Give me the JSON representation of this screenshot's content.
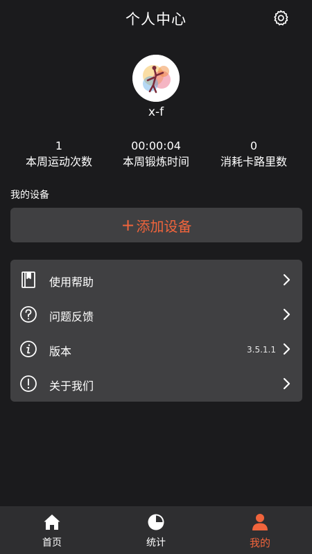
{
  "header": {
    "title": "个人中心",
    "settings_icon": "gear-icon"
  },
  "profile": {
    "username": "x-f",
    "avatar_icon": "runner-avatar-image"
  },
  "stats": [
    {
      "value": "1",
      "label": "本周运动次数"
    },
    {
      "value": "00:00:04",
      "label": "本周锻炼时间"
    },
    {
      "value": "0",
      "label": "消耗卡路里数"
    }
  ],
  "devices": {
    "section_title": "我的设备",
    "add_plus": "+",
    "add_label": "添加设备"
  },
  "menu": {
    "items": [
      {
        "label": "使用帮助",
        "icon": "book-icon"
      },
      {
        "label": "问题反馈",
        "icon": "question-icon"
      },
      {
        "label": "版本",
        "icon": "info-icon",
        "value": "3.5.1.1"
      },
      {
        "label": "关于我们",
        "icon": "exclamation-icon"
      }
    ]
  },
  "tabbar": {
    "tabs": [
      {
        "label": "首页",
        "icon": "home-icon"
      },
      {
        "label": "统计",
        "icon": "pie-chart-icon"
      },
      {
        "label": "我的",
        "icon": "user-icon",
        "active": true
      }
    ]
  },
  "colors": {
    "accent": "#f0643c",
    "background": "#1b1b1d",
    "card": "#404042",
    "tabbar": "#2e2e30"
  }
}
